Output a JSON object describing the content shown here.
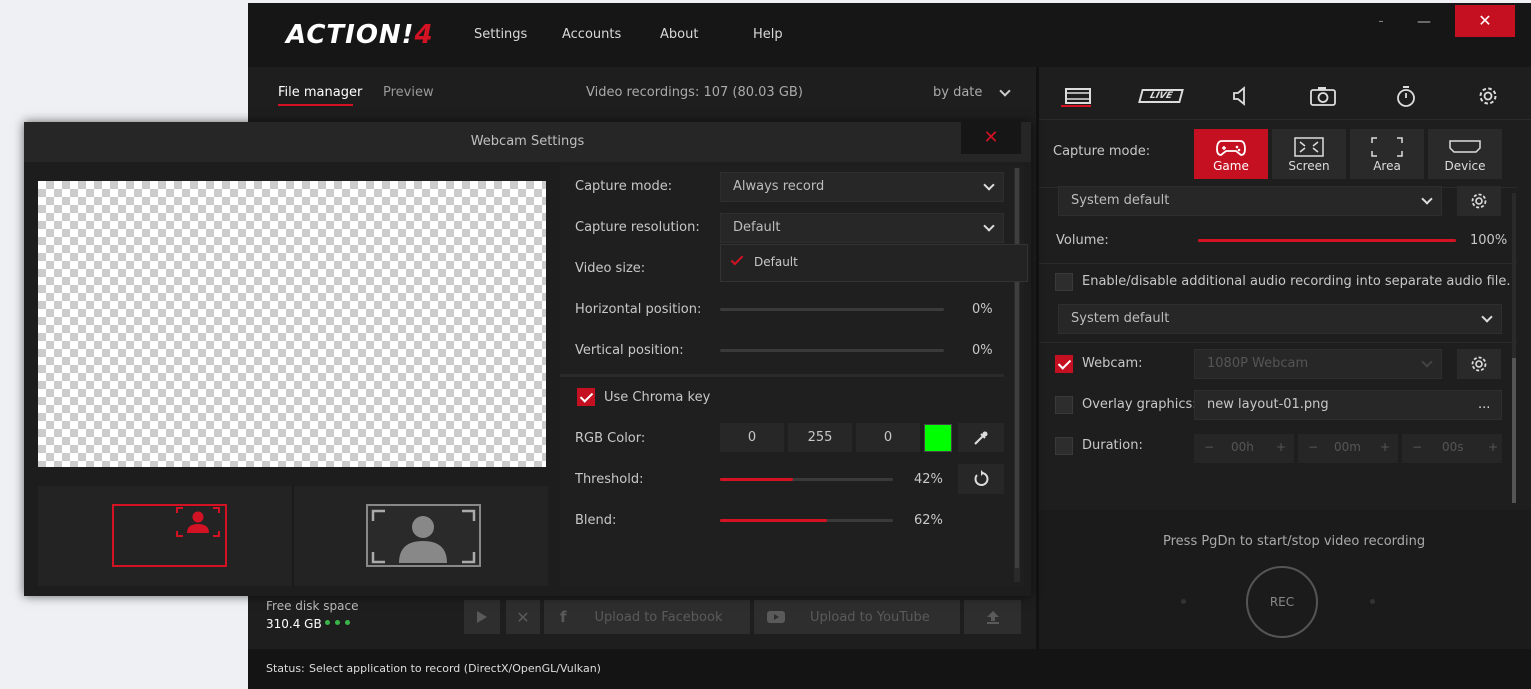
{
  "app": {
    "logo_main": "ACTION!",
    "logo_num": "4",
    "menu": [
      "Settings",
      "Accounts",
      "About",
      "Help"
    ],
    "minimize": "–",
    "maximize": "—",
    "close": "✕"
  },
  "files": {
    "tabs": [
      "File manager",
      "Preview"
    ],
    "recordings_info": "Video recordings: 107 (80.03 GB)",
    "sort_label": "by date"
  },
  "right": {
    "tabs": [
      "video-tab",
      "live-tab",
      "audio-tab",
      "screenshot-tab",
      "timer-tab",
      "settings-tab"
    ],
    "live_label": "LIVE",
    "capture_mode_label": "Capture mode:",
    "capture_modes": [
      "Game",
      "Screen",
      "Area",
      "Device"
    ],
    "active_mode": "Game",
    "audio_device": "System default",
    "volume_label": "Volume:",
    "volume_value": "100%",
    "volume_fraction": 1.0,
    "extra_audio_label": "Enable/disable additional audio recording into separate audio file.",
    "extra_audio_device": "System default",
    "webcam_label": "Webcam:",
    "webcam_device": "1080P Webcam",
    "overlay_label": "Overlay graphics:",
    "overlay_file": "new layout-01.png",
    "overlay_more": "...",
    "duration_label": "Duration:",
    "duration_h": "00h",
    "duration_m": "00m",
    "duration_s": "00s",
    "minus": "−",
    "plus": "+",
    "hint": "Press PgDn to start/stop video recording",
    "rec_label": "REC"
  },
  "bottom": {
    "disk_label": "Free disk space",
    "disk_value": "310.4 GB",
    "upload_facebook": "Upload to Facebook",
    "upload_youtube": "Upload to YouTube",
    "status_label": "Status:",
    "status_text": "Select application to record  (DirectX/OpenGL/Vulkan)"
  },
  "webcam_dialog": {
    "title": "Webcam Settings",
    "close": "✕",
    "capture_mode_label": "Capture mode:",
    "capture_mode_value": "Always record",
    "capture_res_label": "Capture resolution:",
    "capture_res_value": "Default",
    "dropdown_option": "Default",
    "video_size_label": "Video size:",
    "hpos_label": "Horizontal position:",
    "hpos_value": "0%",
    "vpos_label": "Vertical position:",
    "vpos_value": "0%",
    "chroma_label": "Use Chroma key",
    "chroma_checked": true,
    "rgb_label": "RGB Color:",
    "rgb_r": "0",
    "rgb_g": "255",
    "rgb_b": "0",
    "chroma_color": "#00ff00",
    "threshold_label": "Threshold:",
    "threshold_value": "42%",
    "threshold_fraction": 0.42,
    "blend_label": "Blend:",
    "blend_value": "62%",
    "blend_fraction": 0.62
  },
  "colors": {
    "accent": "#d31224",
    "background": "#1e1e1e"
  }
}
